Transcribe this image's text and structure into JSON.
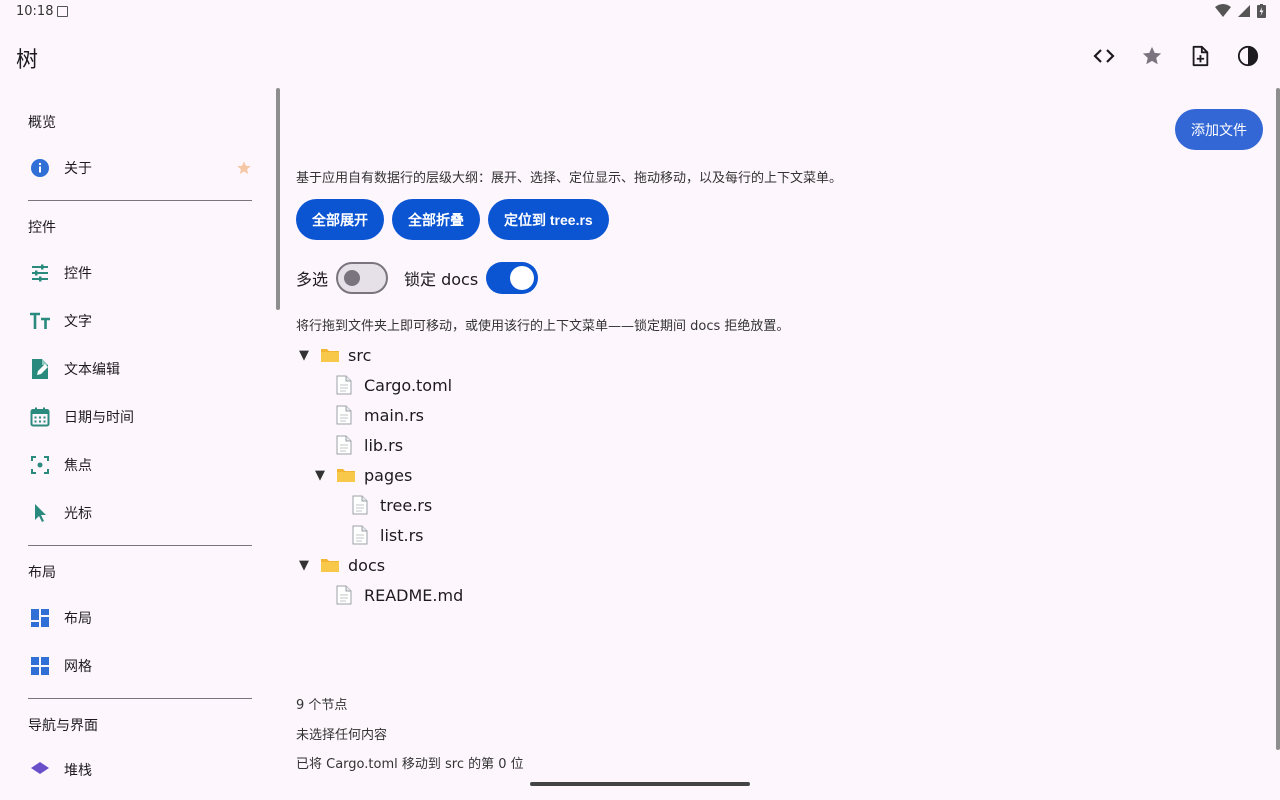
{
  "status": {
    "time": "10:18"
  },
  "app": {
    "title": "树"
  },
  "sidebar": {
    "sections": [
      {
        "title": "概览",
        "items": [
          {
            "label": "关于",
            "icon": "info-icon"
          }
        ]
      },
      {
        "title": "控件",
        "items": [
          {
            "label": "控件",
            "icon": "tune-icon"
          },
          {
            "label": "文字",
            "icon": "text-icon"
          },
          {
            "label": "文本编辑",
            "icon": "edit-note-icon"
          },
          {
            "label": "日期与时间",
            "icon": "calendar-icon"
          },
          {
            "label": "焦点",
            "icon": "focus-icon"
          },
          {
            "label": "光标",
            "icon": "cursor-icon"
          }
        ]
      },
      {
        "title": "布局",
        "items": [
          {
            "label": "布局",
            "icon": "dashboard-icon"
          },
          {
            "label": "网格",
            "icon": "grid-icon"
          }
        ]
      },
      {
        "title": "导航与界面",
        "items": [
          {
            "label": "堆栈",
            "icon": "layers-icon"
          }
        ]
      }
    ]
  },
  "main": {
    "add_file": "添加文件",
    "description": "基于应用自有数据行的层级大纲：展开、选择、定位显示、拖动移动，以及每行的上下文菜单。",
    "buttons": {
      "expand_all": "全部展开",
      "collapse_all": "全部折叠",
      "reveal": "定位到 tree.rs"
    },
    "toggles": {
      "multi_label": "多选",
      "multi_on": false,
      "lock_label": "锁定 docs",
      "lock_on": true
    },
    "hint": "将行拖到文件夹上即可移动，或使用该行的上下文菜单——锁定期间 docs 拒绝放置。",
    "tree": [
      {
        "label": "src",
        "depth": 0,
        "kind": "folder",
        "expanded": true
      },
      {
        "label": "Cargo.toml",
        "depth": 1,
        "kind": "file"
      },
      {
        "label": "main.rs",
        "depth": 1,
        "kind": "file"
      },
      {
        "label": "lib.rs",
        "depth": 1,
        "kind": "file"
      },
      {
        "label": "pages",
        "depth": 1,
        "kind": "folder",
        "expanded": true
      },
      {
        "label": "tree.rs",
        "depth": 2,
        "kind": "file"
      },
      {
        "label": "list.rs",
        "depth": 2,
        "kind": "file"
      },
      {
        "label": "docs",
        "depth": 0,
        "kind": "folder",
        "expanded": true
      },
      {
        "label": "README.md",
        "depth": 1,
        "kind": "file"
      }
    ],
    "tree_toggle_glyph": "▼",
    "footer": {
      "node_count": "9 个节点",
      "selection": "未选择任何内容",
      "last_move": "已将 Cargo.toml 移动到 src 的第 0 位"
    }
  },
  "colors": {
    "accent": "#0b55d3",
    "add_file": "#3467d6",
    "icon_teal": "#2b8a7e",
    "icon_blue": "#2f6fd6",
    "folder": "#f2b632"
  }
}
